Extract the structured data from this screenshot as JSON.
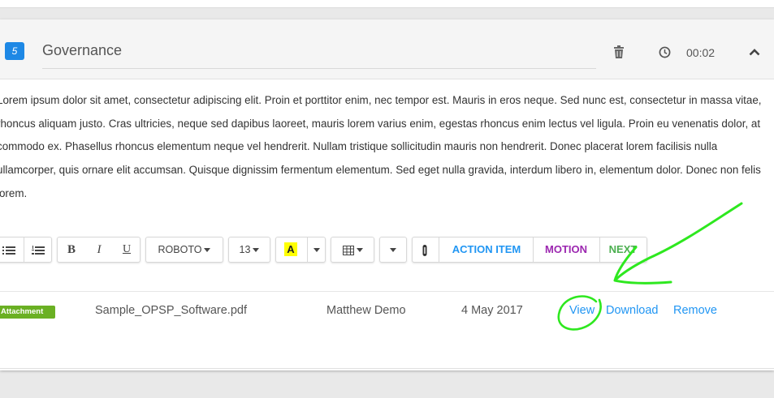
{
  "section": {
    "number": "5",
    "title": "Governance",
    "timer": "00:02"
  },
  "body_text": "Lorem ipsum dolor sit amet, consectetur adipiscing elit. Proin et porttitor enim, nec tempor est. Mauris in eros neque. Sed nunc est, consectetur in massa vitae, rhoncus aliquam justo. Cras ultricies, neque sed dapibus laoreet, mauris lorem varius enim, egestas rhoncus enim lectus vel ligula. Proin eu venenatis dolor, at commodo ex. Phasellus rhoncus elementum neque vel hendrerit. Nullam tristique sollicitudin mauris non hendrerit. Donec placerat lorem facilisis nulla ullamcorper, quis ornare elit accumsan. Quisque dignissim fermentum elementum. Sed eget nulla gravida, interdum libero in, elementum dolor. Donec non felis lorem.",
  "toolbar": {
    "bold": "B",
    "italic": "I",
    "underline": "U",
    "font": "ROBOTO",
    "size": "13",
    "highlight": "A",
    "action_item": "ACTION ITEM",
    "motion": "MOTION",
    "next": "NEXT"
  },
  "attachment": {
    "badge": "Attachment",
    "file_name": "Sample_OPSP_Software.pdf",
    "uploader": "Matthew Demo",
    "date": "4 May 2017",
    "view": "View",
    "download": "Download",
    "remove": "Remove"
  },
  "colors": {
    "badge_blue": "#1e88e5",
    "attachment_green": "#6ab023",
    "link_blue": "#2196f3",
    "motion_purple": "#9c27b0",
    "next_green": "#4caf50",
    "annotation_green": "#2ee81f"
  }
}
